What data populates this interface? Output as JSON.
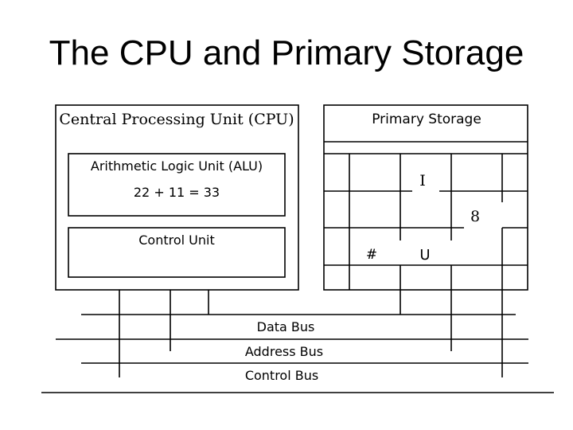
{
  "title": "The CPU and Primary Storage",
  "cpu": {
    "label": "Central Processing Unit (CPU)",
    "alu": {
      "label": "Arithmetic Logic Unit (ALU)",
      "expression": "22 + 11 = 33"
    },
    "control_unit": {
      "label": "Control Unit"
    }
  },
  "primary_storage": {
    "label": "Primary Storage",
    "cell_symbols": [
      "I",
      "8",
      "#",
      "U"
    ]
  },
  "buses": [
    {
      "label": "Data Bus"
    },
    {
      "label": "Address Bus"
    },
    {
      "label": "Control Bus"
    }
  ]
}
